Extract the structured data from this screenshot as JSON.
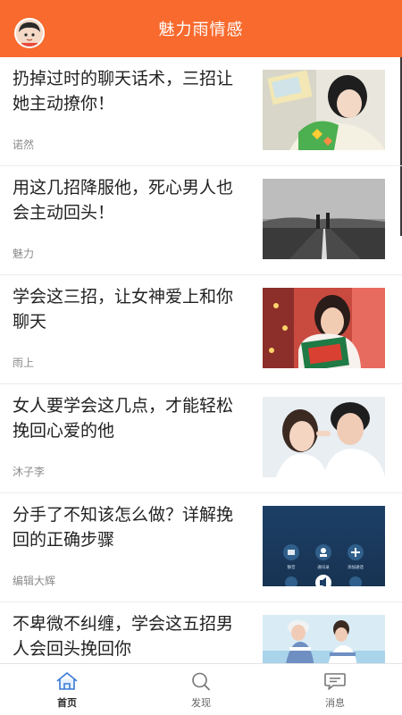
{
  "header": {
    "title": "魅力雨情感",
    "accent_color": "#f86a2d"
  },
  "feed": {
    "articles": [
      {
        "title": "扔掉过时的聊天话术，三招让她主动撩你！",
        "author": "诺然",
        "image": "girl-reading-photo"
      },
      {
        "title": "用这几招降服他，死心男人也会主动回头！",
        "author": "魅力",
        "image": "couple-on-road-photo"
      },
      {
        "title": "学会这三招，让女神爱上和你聊天",
        "author": "雨上",
        "image": "girl-with-christmas-pillow-photo"
      },
      {
        "title": "女人要学会这几点，才能轻松挽回心爱的他",
        "author": "沐子李",
        "image": "couple-smiling-photo"
      },
      {
        "title": "分手了不知该怎么做？详解挽回的正确步骤",
        "author": "编辑大辉",
        "image": "phone-call-screen-photo"
      },
      {
        "title": "不卑微不纠缠，学会这五招男人会回头挽回你",
        "author": "",
        "image": "couple-at-beach-photo"
      }
    ],
    "call_screen": {
      "btn1": "静音",
      "btn2": "通讯录",
      "btn3": "添加通话"
    }
  },
  "tabbar": {
    "tabs": [
      {
        "label": "首页",
        "icon": "home-icon",
        "active": true
      },
      {
        "label": "发现",
        "icon": "search-icon",
        "active": false
      },
      {
        "label": "消息",
        "icon": "chat-icon",
        "active": false
      }
    ],
    "active_color": "#3a7bd5"
  }
}
